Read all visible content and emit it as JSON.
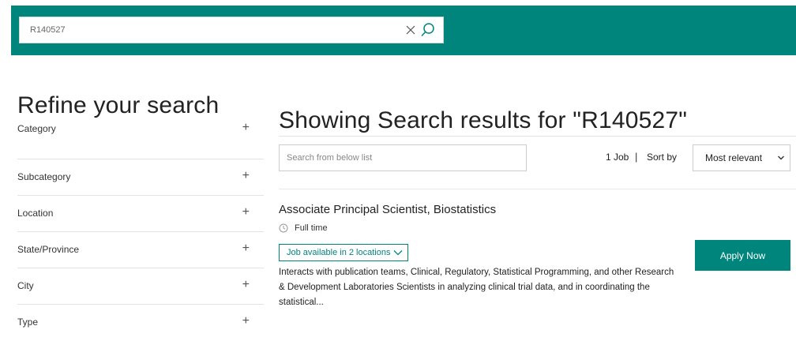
{
  "search": {
    "value": "R140527",
    "clear_icon": "close-icon",
    "search_icon": "search-icon"
  },
  "sidebar": {
    "title": "Refine your search",
    "facets": [
      {
        "label": "Category",
        "toggle": "+"
      },
      {
        "label": "Subcategory",
        "toggle": "+"
      },
      {
        "label": "Location",
        "toggle": "+"
      },
      {
        "label": "State/Province",
        "toggle": "+"
      },
      {
        "label": "City",
        "toggle": "+"
      },
      {
        "label": "Type",
        "toggle": "+"
      }
    ]
  },
  "results": {
    "title": "Showing Search results for \"R140527\"",
    "filter_placeholder": "Search from below list",
    "count": "1 Job",
    "separator": "|",
    "sort_label": "Sort by",
    "sort_value": "Most relevant"
  },
  "job": {
    "title": "Associate Principal Scientist, Biostatistics",
    "type": "Full time",
    "locations_label": "Job available in 2 locations",
    "description": "Interacts with publication teams, Clinical, Regulatory, Statistical Programming, and other Research & Development Laboratories Scientists in analyzing clinical trial data, and in coordinating the statistical...",
    "apply_label": "Apply Now"
  },
  "colors": {
    "brand": "#00857c",
    "text": "#222222",
    "divider": "#e3e3e3"
  }
}
